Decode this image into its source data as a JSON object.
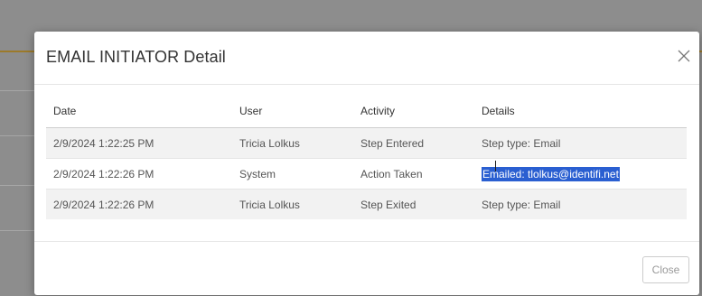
{
  "modal": {
    "title": "EMAIL INITIATOR Detail",
    "close_icon": "close-icon",
    "close_button_label": "Close"
  },
  "table": {
    "headers": [
      "Date",
      "User",
      "Activity",
      "Details"
    ],
    "rows": [
      {
        "date": "2/9/2024 1:22:25 PM",
        "user": "Tricia Lolkus",
        "activity": "Step Entered",
        "details": "Step type: Email"
      },
      {
        "date": "2/9/2024 1:22:26 PM",
        "user": "System",
        "activity": "Action Taken",
        "details": "Emailed: tlolkus@identifi.net"
      },
      {
        "date": "2/9/2024 1:22:26 PM",
        "user": "Tricia Lolkus",
        "activity": "Step Exited",
        "details": "Step type: Email"
      }
    ],
    "selected_text_color": "#2a5fd1"
  }
}
